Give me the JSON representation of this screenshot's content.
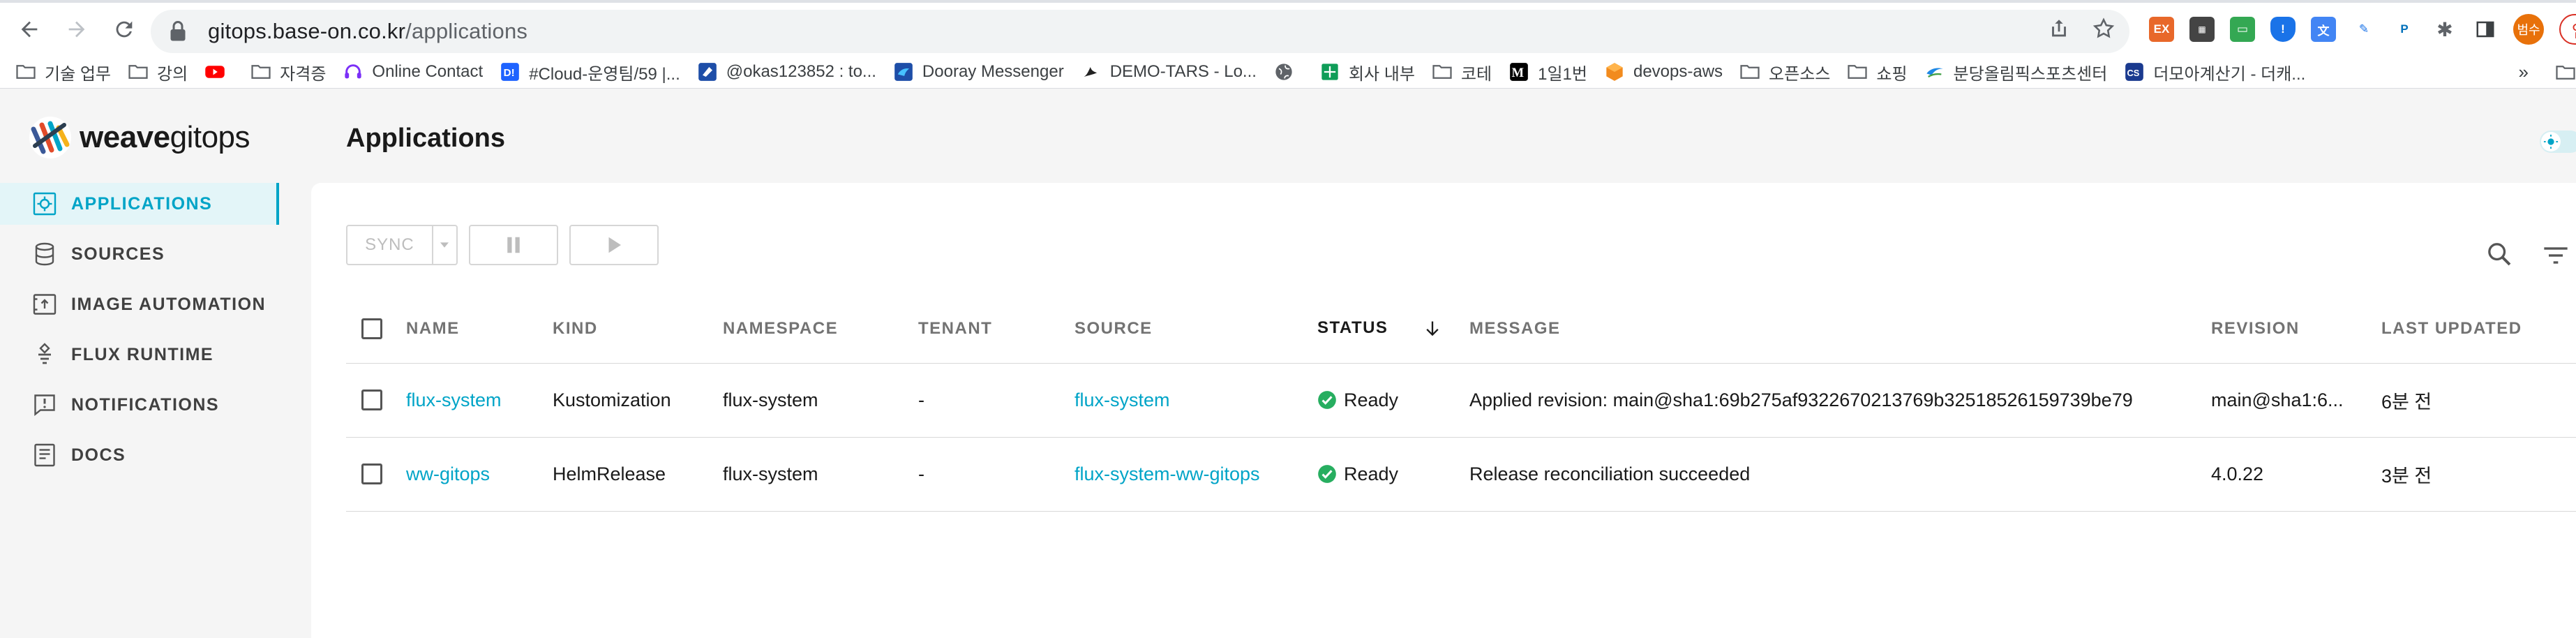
{
  "browser": {
    "url_host": "gitops.base-on.co.kr",
    "url_path": "/applications",
    "bookmarks": [
      {
        "label": "기술 업무",
        "icon": "folder"
      },
      {
        "label": "강의",
        "icon": "folder"
      },
      {
        "label": "",
        "icon": "youtube"
      },
      {
        "label": "자격증",
        "icon": "folder"
      },
      {
        "label": "Online Contact",
        "icon": "headset"
      },
      {
        "label": "#Cloud-운영팀/59 |...",
        "icon": "dooray"
      },
      {
        "label": "@okas123852 : to...",
        "icon": "dooray-note"
      },
      {
        "label": "Dooray Messenger",
        "icon": "dooray-messenger"
      },
      {
        "label": "DEMO-TARS - Lo...",
        "icon": "tars"
      },
      {
        "label": "",
        "icon": "globe"
      },
      {
        "label": "회사 내부",
        "icon": "sheets"
      },
      {
        "label": "코테",
        "icon": "folder"
      },
      {
        "label": "1일1번",
        "icon": "medium"
      },
      {
        "label": "devops-aws",
        "icon": "aws"
      },
      {
        "label": "오픈소스",
        "icon": "folder"
      },
      {
        "label": "쇼핑",
        "icon": "folder"
      },
      {
        "label": "분당올림픽스포츠센터",
        "icon": "sports"
      },
      {
        "label": "더모아계산기 - 더캐...",
        "icon": "calc"
      }
    ],
    "more": "»",
    "profile_initials": "범수",
    "update_label": "업"
  },
  "app": {
    "logo_text_bold": "weave",
    "logo_text_light": "gitops",
    "page_title": "Applications",
    "sidebar": [
      {
        "label": "APPLICATIONS",
        "icon": "applications-icon",
        "active": true
      },
      {
        "label": "SOURCES",
        "icon": "sources-icon",
        "active": false
      },
      {
        "label": "IMAGE AUTOMATION",
        "icon": "image-automation-icon",
        "active": false
      },
      {
        "label": "FLUX RUNTIME",
        "icon": "flux-runtime-icon",
        "active": false
      },
      {
        "label": "NOTIFICATIONS",
        "icon": "notifications-icon",
        "active": false
      },
      {
        "label": "DOCS",
        "icon": "docs-icon",
        "active": false
      }
    ],
    "toolbar": {
      "sync_label": "SYNC"
    },
    "table": {
      "columns": [
        "NAME",
        "KIND",
        "NAMESPACE",
        "TENANT",
        "SOURCE",
        "STATUS",
        "MESSAGE",
        "REVISION",
        "LAST UPDATED"
      ],
      "rows": [
        {
          "name": "flux-system",
          "kind": "Kustomization",
          "namespace": "flux-system",
          "tenant": "-",
          "source": "flux-system",
          "status": "Ready",
          "message": "Applied revision: main@sha1:69b275af9322670213769b32518526159739be79",
          "revision": "main@sha1:6...",
          "last_updated": "6분 전"
        },
        {
          "name": "ww-gitops",
          "kind": "HelmRelease",
          "namespace": "flux-system",
          "tenant": "-",
          "source": "flux-system-ww-gitops",
          "status": "Ready",
          "message": "Release reconciliation succeeded",
          "revision": "4.0.22",
          "last_updated": "3분 전"
        }
      ]
    },
    "colors": {
      "accent": "#00a4c7",
      "ready": "#27ae60",
      "active_bg": "#e3f5f8"
    }
  }
}
